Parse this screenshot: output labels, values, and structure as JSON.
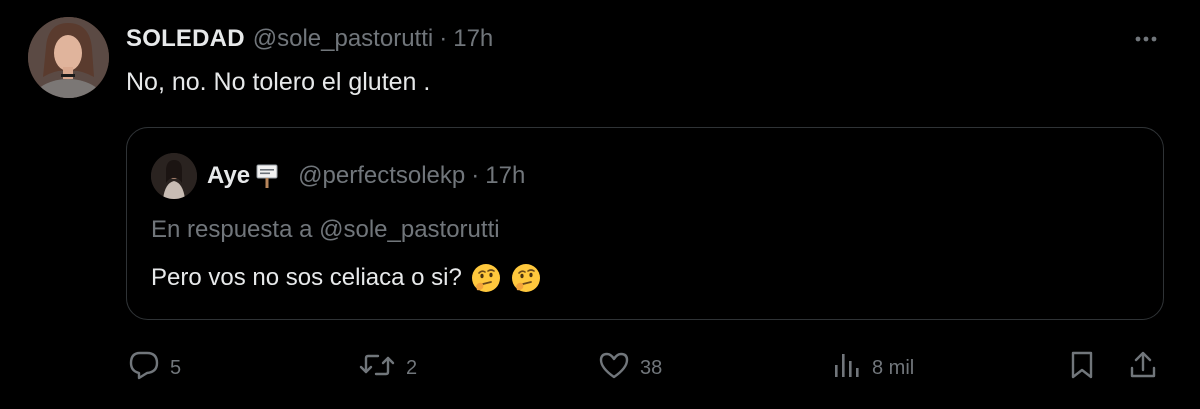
{
  "tweet": {
    "author": {
      "display_name": "SOLEDAD",
      "handle": "@sole_pastorutti",
      "separator": "·",
      "time": "17h"
    },
    "text": "No, no. No tolero el gluten .",
    "quoted": {
      "display_name": "Aye",
      "name_emoji": "signpost",
      "handle": "@perfectsolekp",
      "separator": "·",
      "time": "17h",
      "reply_to": "En respuesta a @sole_pastorutti",
      "text": "Pero vos no sos celiaca o si?",
      "emojis": [
        "thinking-face",
        "thinking-face"
      ]
    },
    "actions": {
      "replies": "5",
      "retweets": "2",
      "likes": "38",
      "views": "8 mil"
    },
    "icons": {
      "more": "more-horizontal-icon",
      "reply": "comment-bubble-icon",
      "retweet": "retweet-icon",
      "like": "heart-icon",
      "views": "bar-chart-icon",
      "bookmark": "bookmark-icon",
      "share": "share-upload-icon"
    },
    "colors": {
      "background": "#000000",
      "primary_text": "#e7e9ea",
      "secondary_text": "#71767b",
      "border": "#2f3336"
    }
  }
}
